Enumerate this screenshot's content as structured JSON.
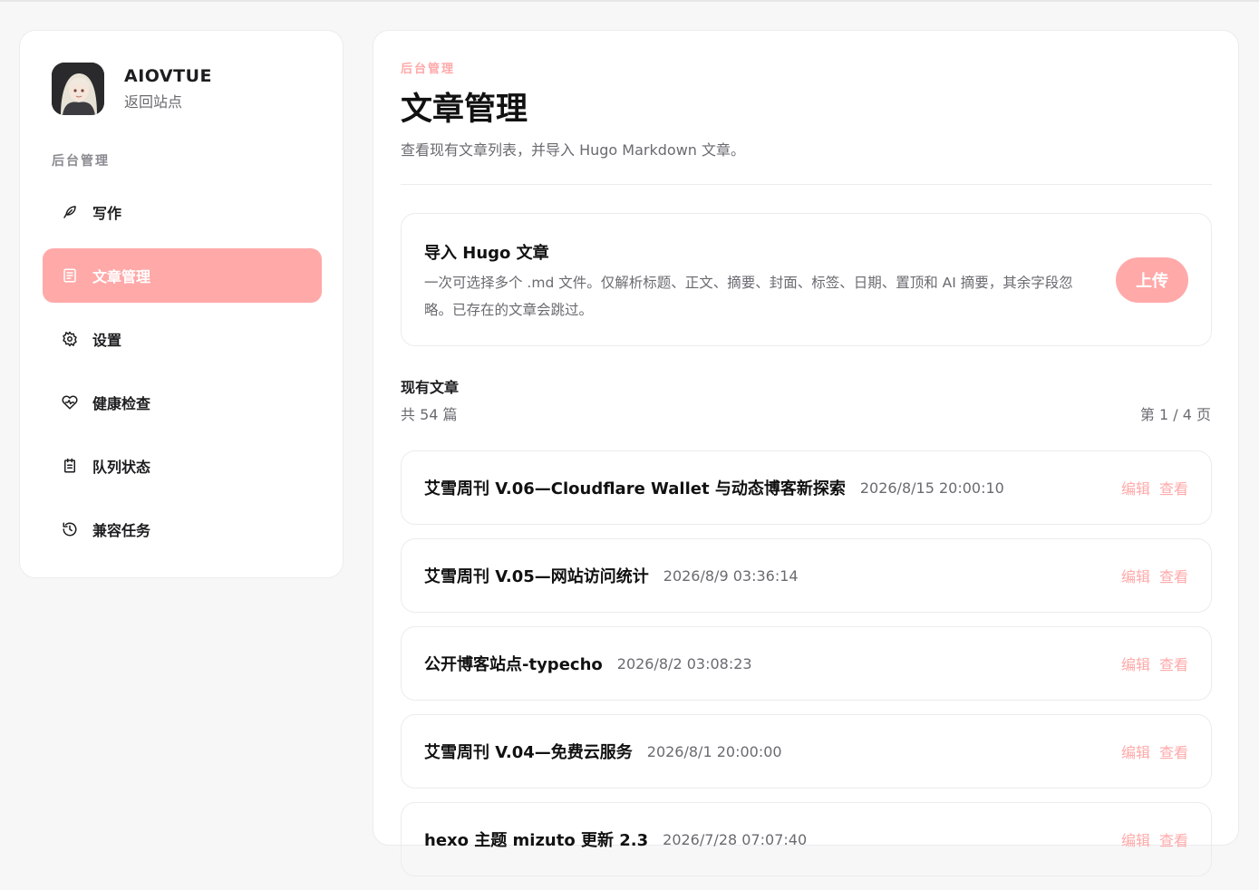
{
  "sidebar": {
    "site_name": "AIOVTUE",
    "back_link": "返回站点",
    "section_label": "后台管理",
    "items": [
      {
        "label": "写作",
        "icon": "feather-icon",
        "active": false
      },
      {
        "label": "文章管理",
        "icon": "document-icon",
        "active": true
      },
      {
        "label": "设置",
        "icon": "gear-icon",
        "active": false
      },
      {
        "label": "健康检查",
        "icon": "heart-pulse-icon",
        "active": false
      },
      {
        "label": "队列状态",
        "icon": "clipboard-icon",
        "active": false
      },
      {
        "label": "兼容任务",
        "icon": "history-icon",
        "active": false
      }
    ]
  },
  "main": {
    "eyebrow": "后台管理",
    "title": "文章管理",
    "description": "查看现有文章列表，并导入 Hugo Markdown 文章。",
    "import": {
      "title": "导入 Hugo 文章",
      "description": "一次可选择多个 .md 文件。仅解析标题、正文、摘要、封面、标签、日期、置顶和 AI 摘要，其余字段忽略。已存在的文章会跳过。",
      "upload_label": "上传"
    },
    "list": {
      "heading": "现有文章",
      "count": "共 54 篇",
      "page": "第 1 / 4 页",
      "edit_label": "编辑",
      "view_label": "查看",
      "articles": [
        {
          "title": "艾雪周刊 V.06—Cloudflare Wallet 与动态博客新探索",
          "date": "2026/8/15 20:00:10"
        },
        {
          "title": "艾雪周刊 V.05—网站访问统计",
          "date": "2026/8/9 03:36:14"
        },
        {
          "title": "公开博客站点-typecho",
          "date": "2026/8/2 03:08:23"
        },
        {
          "title": "艾雪周刊 V.04—免费云服务",
          "date": "2026/8/1 20:00:00"
        },
        {
          "title": "hexo 主题 mizuto 更新 2.3",
          "date": "2026/7/28 07:07:40"
        }
      ]
    }
  },
  "colors": {
    "accent": "#ffa9a9",
    "muted_text": "#6a6a70",
    "border": "#ececee"
  }
}
